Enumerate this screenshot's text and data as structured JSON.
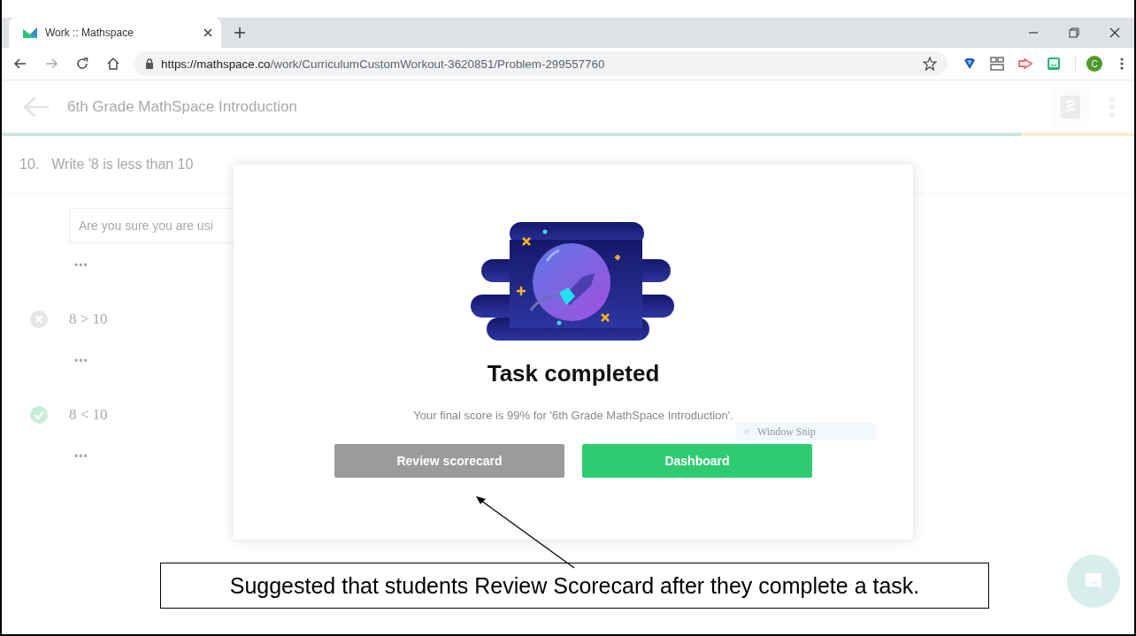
{
  "browser": {
    "tab_title": "Work :: Mathspace",
    "url_host": "https://mathspace.co",
    "url_path": "/work/CurriculumCustomWorkout-3620851/Problem-299557760",
    "profile_initial": "C"
  },
  "page": {
    "title": "6th Grade MathSpace Introduction",
    "question_number": "10.",
    "question_text": "Write '8 is less than 10",
    "input_placeholder": "Are you sure you are usi",
    "progress": {
      "level": 0.9
    },
    "steps": [
      {
        "dots": "•••"
      },
      {
        "expression": "8 > 10",
        "correct": false,
        "dots": "•••"
      },
      {
        "expression": "8 < 10",
        "correct": true,
        "dots": "•••"
      }
    ]
  },
  "modal": {
    "title": "Task completed",
    "message": "Your final score is 99% for '6th Grade MathSpace Introduction'.",
    "buttons": [
      {
        "label": "Review scorecard",
        "kind": "secondary"
      },
      {
        "label": "Dashboard",
        "kind": "primary"
      }
    ]
  },
  "tooltip": {
    "label": "Window Snip"
  },
  "callout": {
    "text": "Suggested that students Review Scorecard after they complete a task."
  }
}
